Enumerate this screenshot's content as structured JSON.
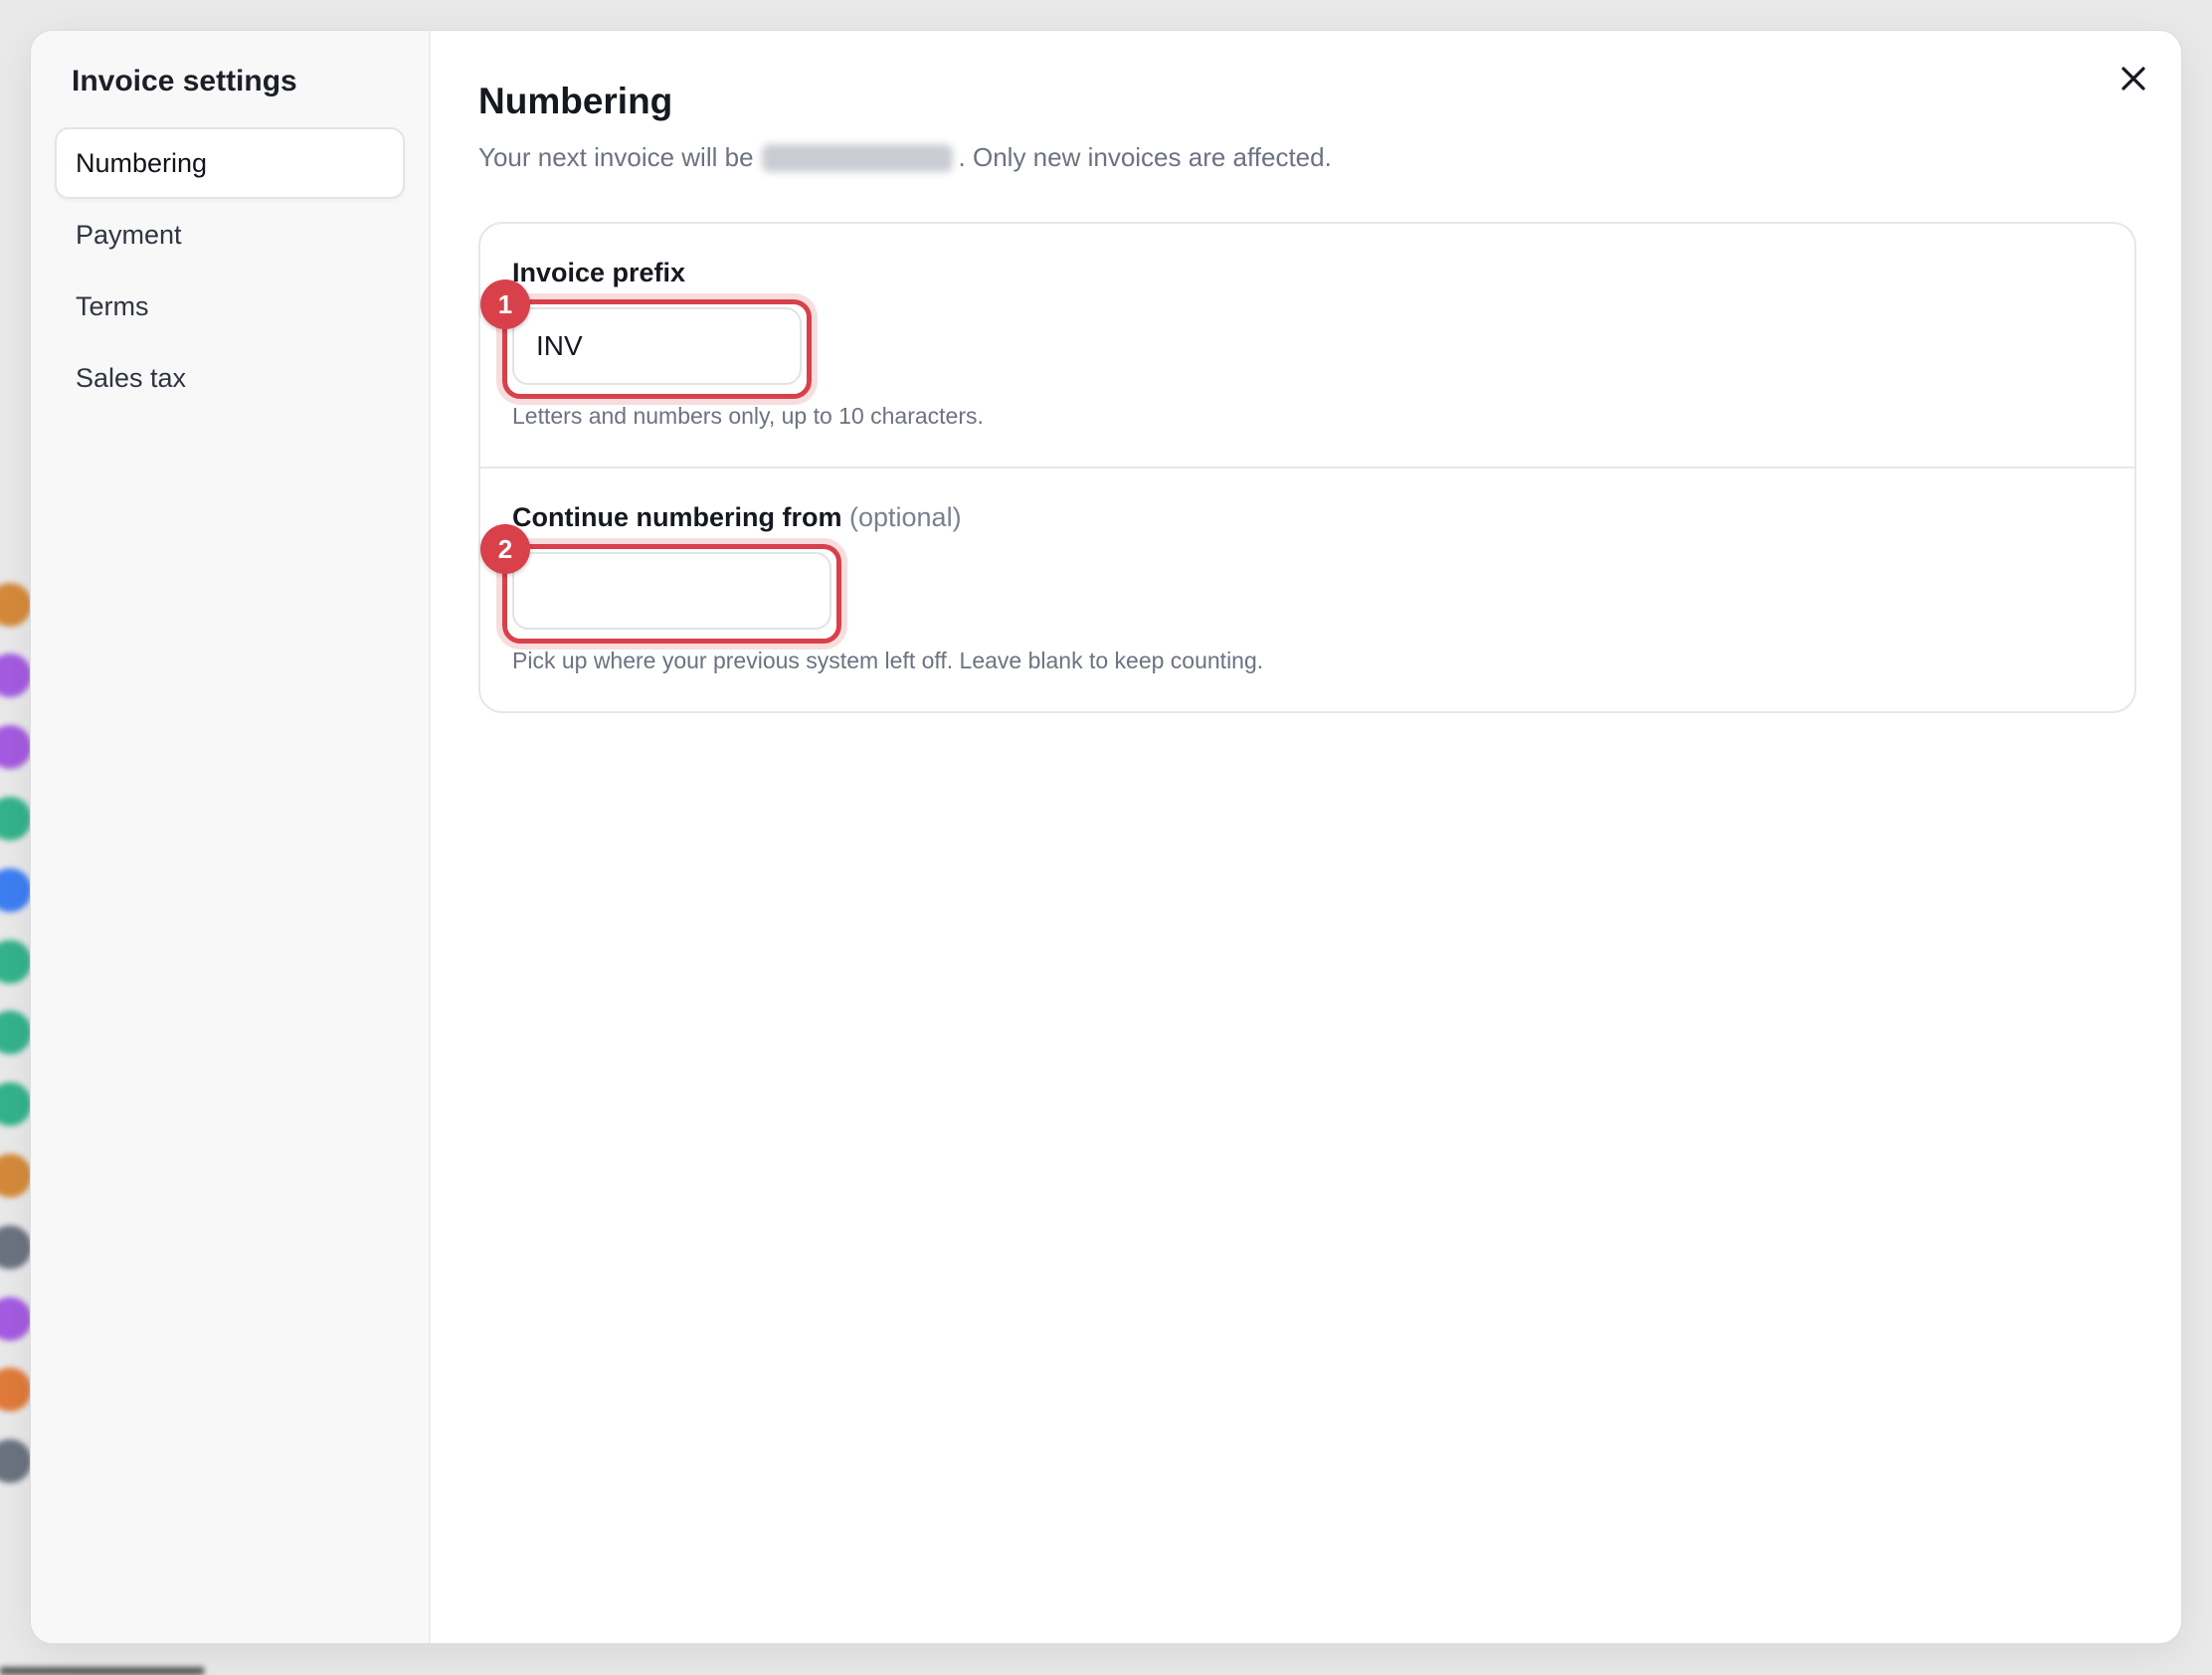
{
  "sidebar": {
    "title": "Invoice settings",
    "items": [
      {
        "label": "Numbering",
        "active": true
      },
      {
        "label": "Payment",
        "active": false
      },
      {
        "label": "Terms",
        "active": false
      },
      {
        "label": "Sales tax",
        "active": false
      }
    ]
  },
  "main": {
    "title": "Numbering",
    "subtitle_prefix": "Your next invoice will be",
    "subtitle_suffix": ". Only new invoices are affected.",
    "fields": [
      {
        "label": "Invoice prefix",
        "optional": "",
        "value": "INV",
        "help": "Letters and numbers only, up to 10 characters.",
        "badge": "1"
      },
      {
        "label": "Continue numbering from",
        "optional": "(optional)",
        "value": "",
        "help": "Pick up where your previous system left off. Leave blank to keep counting.",
        "badge": "2"
      }
    ]
  },
  "icons": {
    "close": "close-icon"
  },
  "colors": {
    "accent_highlight": "#d9414a",
    "text_primary": "#15181e",
    "text_muted": "#6c7280",
    "sidebar_bg": "#f8f8f9"
  }
}
